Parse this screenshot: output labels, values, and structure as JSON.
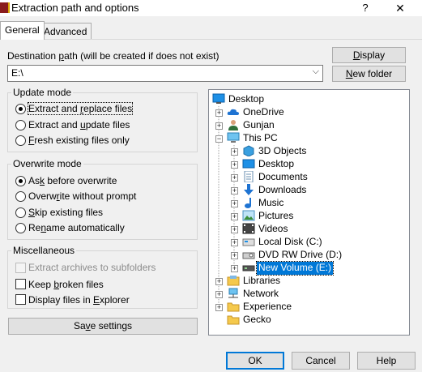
{
  "window": {
    "title": "Extraction path and options",
    "help_glyph": "?",
    "close_glyph": "✕"
  },
  "tabs": [
    {
      "label": "General"
    },
    {
      "label": "Advanced"
    }
  ],
  "destination": {
    "label_pre": "Destination ",
    "label_ul": "p",
    "label_post": "ath (will be created if does not exist)",
    "value": "E:\\",
    "arrow": "⌵"
  },
  "buttons": {
    "display": {
      "ul": "D",
      "rest": "isplay"
    },
    "new_folder": {
      "pre": "",
      "ul": "N",
      "rest": "ew folder"
    },
    "save": {
      "pre": "Sa",
      "ul": "v",
      "rest": "e settings"
    },
    "ok": "OK",
    "cancel": "Cancel",
    "help": "Help"
  },
  "update_mode": {
    "title": "Update mode",
    "options": [
      {
        "pre": "Extract and ",
        "ul": "r",
        "post": "eplace files",
        "checked": true
      },
      {
        "pre": "Extract and ",
        "ul": "u",
        "post": "pdate files",
        "checked": false
      },
      {
        "pre": "",
        "ul": "F",
        "post": "resh existing files only",
        "checked": false
      }
    ]
  },
  "overwrite_mode": {
    "title": "Overwrite mode",
    "options": [
      {
        "pre": "As",
        "ul": "k",
        "post": " before overwrite",
        "checked": true
      },
      {
        "pre": "Overw",
        "ul": "r",
        "post": "ite without prompt",
        "checked": false
      },
      {
        "pre": "",
        "ul": "S",
        "post": "kip existing files",
        "checked": false
      },
      {
        "pre": "Re",
        "ul": "n",
        "post": "ame automatically",
        "checked": false
      }
    ]
  },
  "misc": {
    "title": "Miscellaneous",
    "options": [
      {
        "pre": "Extract archives to subfolders",
        "ul": "",
        "post": "",
        "disabled": true
      },
      {
        "pre": "Keep ",
        "ul": "b",
        "post": "roken files",
        "disabled": false
      },
      {
        "pre": "Display files in ",
        "ul": "E",
        "post": "xplorer",
        "disabled": false
      }
    ]
  },
  "tree": {
    "items": [
      {
        "label": "Desktop",
        "icon": "desktop-blue-icon"
      },
      {
        "label": "OneDrive",
        "icon": "cloud-icon"
      },
      {
        "label": "Gunjan",
        "icon": "user-icon"
      },
      {
        "label": "This PC",
        "icon": "computer-icon"
      },
      {
        "label": "3D Objects",
        "icon": "3d-objects-icon"
      },
      {
        "label": "Desktop",
        "icon": "desktop-icon"
      },
      {
        "label": "Documents",
        "icon": "documents-icon"
      },
      {
        "label": "Downloads",
        "icon": "downloads-icon"
      },
      {
        "label": "Music",
        "icon": "music-icon"
      },
      {
        "label": "Pictures",
        "icon": "pictures-icon"
      },
      {
        "label": "Videos",
        "icon": "videos-icon"
      },
      {
        "label": "Local Disk (C:)",
        "icon": "local-disk-icon"
      },
      {
        "label": "DVD RW Drive (D:)",
        "icon": "dvd-drive-icon"
      },
      {
        "label": "New Volume (E:)",
        "icon": "drive-icon",
        "selected": true
      },
      {
        "label": "Libraries",
        "icon": "libraries-icon"
      },
      {
        "label": "Network",
        "icon": "network-icon"
      },
      {
        "label": "Experience",
        "icon": "folder-icon"
      },
      {
        "label": "Gecko",
        "icon": "folder-icon"
      }
    ],
    "plus": "+"
  },
  "colors": {
    "accent": "#0078d7",
    "folder": "#f5c94c"
  }
}
